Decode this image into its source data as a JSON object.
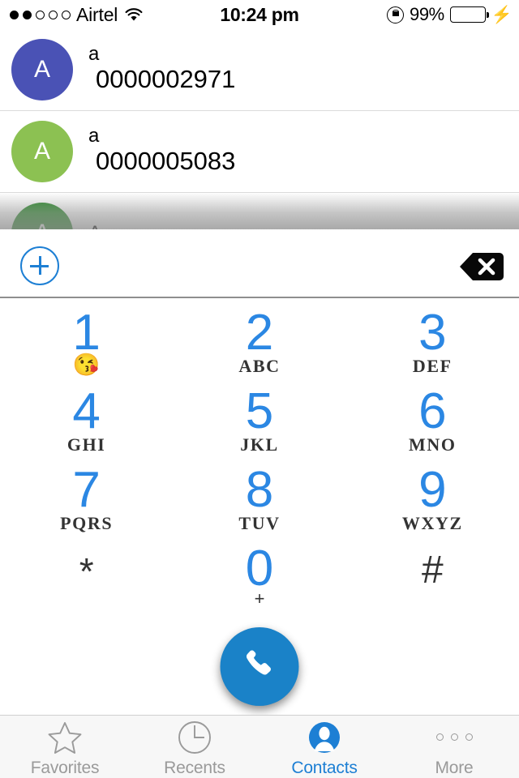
{
  "status_bar": {
    "signal_dots_total": 5,
    "signal_dots_filled": 2,
    "carrier": "Airtel",
    "wifi_icon": "wifi-icon",
    "time": "10:24 pm",
    "rotation_lock_icon": "rotation-lock-icon",
    "battery_percent": "99%",
    "battery_level": 99,
    "battery_color": "#44d362",
    "charging_icon": "lightning-bolt-icon"
  },
  "contacts": {
    "rows": [
      {
        "initial": "A",
        "name": "a",
        "number": "0000002971",
        "avatar_color": "#4a52b5"
      },
      {
        "initial": "A",
        "name": "a",
        "number": "0000005083",
        "avatar_color": "#8cc152"
      },
      {
        "initial": "A",
        "name": "A",
        "number": "",
        "avatar_color": "#2e8b2e"
      }
    ]
  },
  "dialer": {
    "add_contact_label": "+",
    "add_contact_icon": "plus-circle-icon",
    "backspace_icon": "backspace-icon",
    "number_input_value": "",
    "number_input_placeholder": "",
    "accent_color": "#1d7fd4",
    "keys": [
      {
        "digit": "1",
        "sub": "",
        "emoji": "😘"
      },
      {
        "digit": "2",
        "sub": "ABC",
        "emoji": ""
      },
      {
        "digit": "3",
        "sub": "DEF",
        "emoji": ""
      },
      {
        "digit": "4",
        "sub": "GHI",
        "emoji": ""
      },
      {
        "digit": "5",
        "sub": "JKL",
        "emoji": ""
      },
      {
        "digit": "6",
        "sub": "MNO",
        "emoji": ""
      },
      {
        "digit": "7",
        "sub": "PQRS",
        "emoji": ""
      },
      {
        "digit": "8",
        "sub": "TUV",
        "emoji": ""
      },
      {
        "digit": "9",
        "sub": "WXYZ",
        "emoji": ""
      },
      {
        "digit": "*",
        "sub": "",
        "emoji": ""
      },
      {
        "digit": "0",
        "sub": "+",
        "emoji": ""
      },
      {
        "digit": "#",
        "sub": "",
        "emoji": ""
      }
    ],
    "call_button": {
      "icon": "phone-handset-icon",
      "color": "#1a82c8"
    }
  },
  "tab_bar": {
    "items": [
      {
        "label": "Favorites",
        "icon": "star-icon",
        "active": false
      },
      {
        "label": "Recents",
        "icon": "clock-icon",
        "active": false
      },
      {
        "label": "Contacts",
        "icon": "person-circle-icon",
        "active": true
      },
      {
        "label": "More",
        "icon": "ellipsis-icon",
        "active": false
      }
    ],
    "active_color": "#1d7fd4",
    "inactive_color": "#9a9a9a"
  }
}
